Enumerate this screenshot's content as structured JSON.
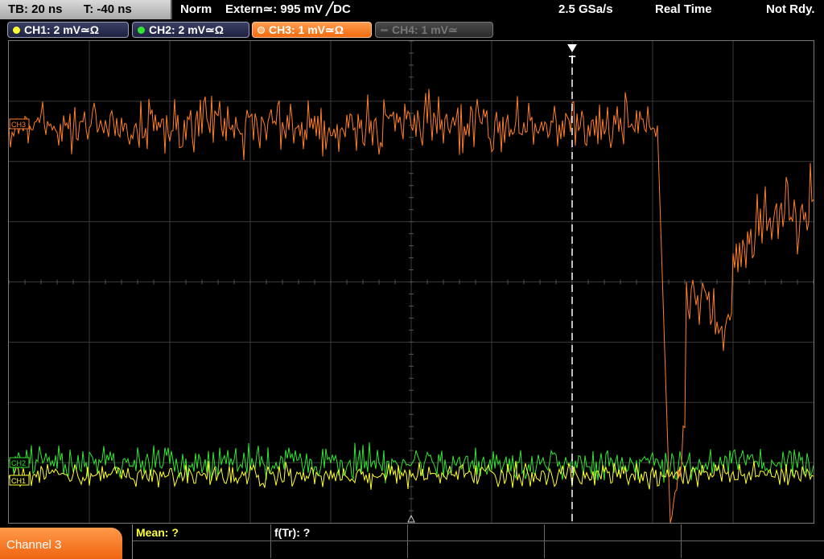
{
  "header": {
    "timebase": "TB: 20 ns",
    "time_offset": "T: -40 ns",
    "trigger_mode": "Norm",
    "trigger_source": "Extern≃: 995 mV ╱DC",
    "sample_rate": "2.5 GSa/s",
    "acq_mode": "Real Time",
    "status": "Not Rdy."
  },
  "channels": [
    {
      "label": "CH1: 2 mV≃Ω",
      "color": "#ffff33",
      "marker": "CH1"
    },
    {
      "label": "CH2: 2 mV≃Ω",
      "color": "#33e533",
      "marker": "CH2"
    },
    {
      "label": "CH3: 1 mV≃Ω",
      "color": "#ff7f2a",
      "marker": "CH3"
    },
    {
      "label": "CH4: 1 mV≃",
      "color": "#777777",
      "marker": "CH4"
    }
  ],
  "trigger_marker": "T",
  "bottom": {
    "active_channel": "Channel 3",
    "measurements": [
      {
        "label": "Mean: ?",
        "color": "#ffff33"
      },
      {
        "label": "f(Tr): ?",
        "color": "#ffffff"
      }
    ]
  },
  "colors": {
    "ch1": "#ffff33",
    "ch2": "#33e533",
    "ch3": "#ff7f2a",
    "grid": "#3a3a3a",
    "active_tab": "#f26a10"
  }
}
